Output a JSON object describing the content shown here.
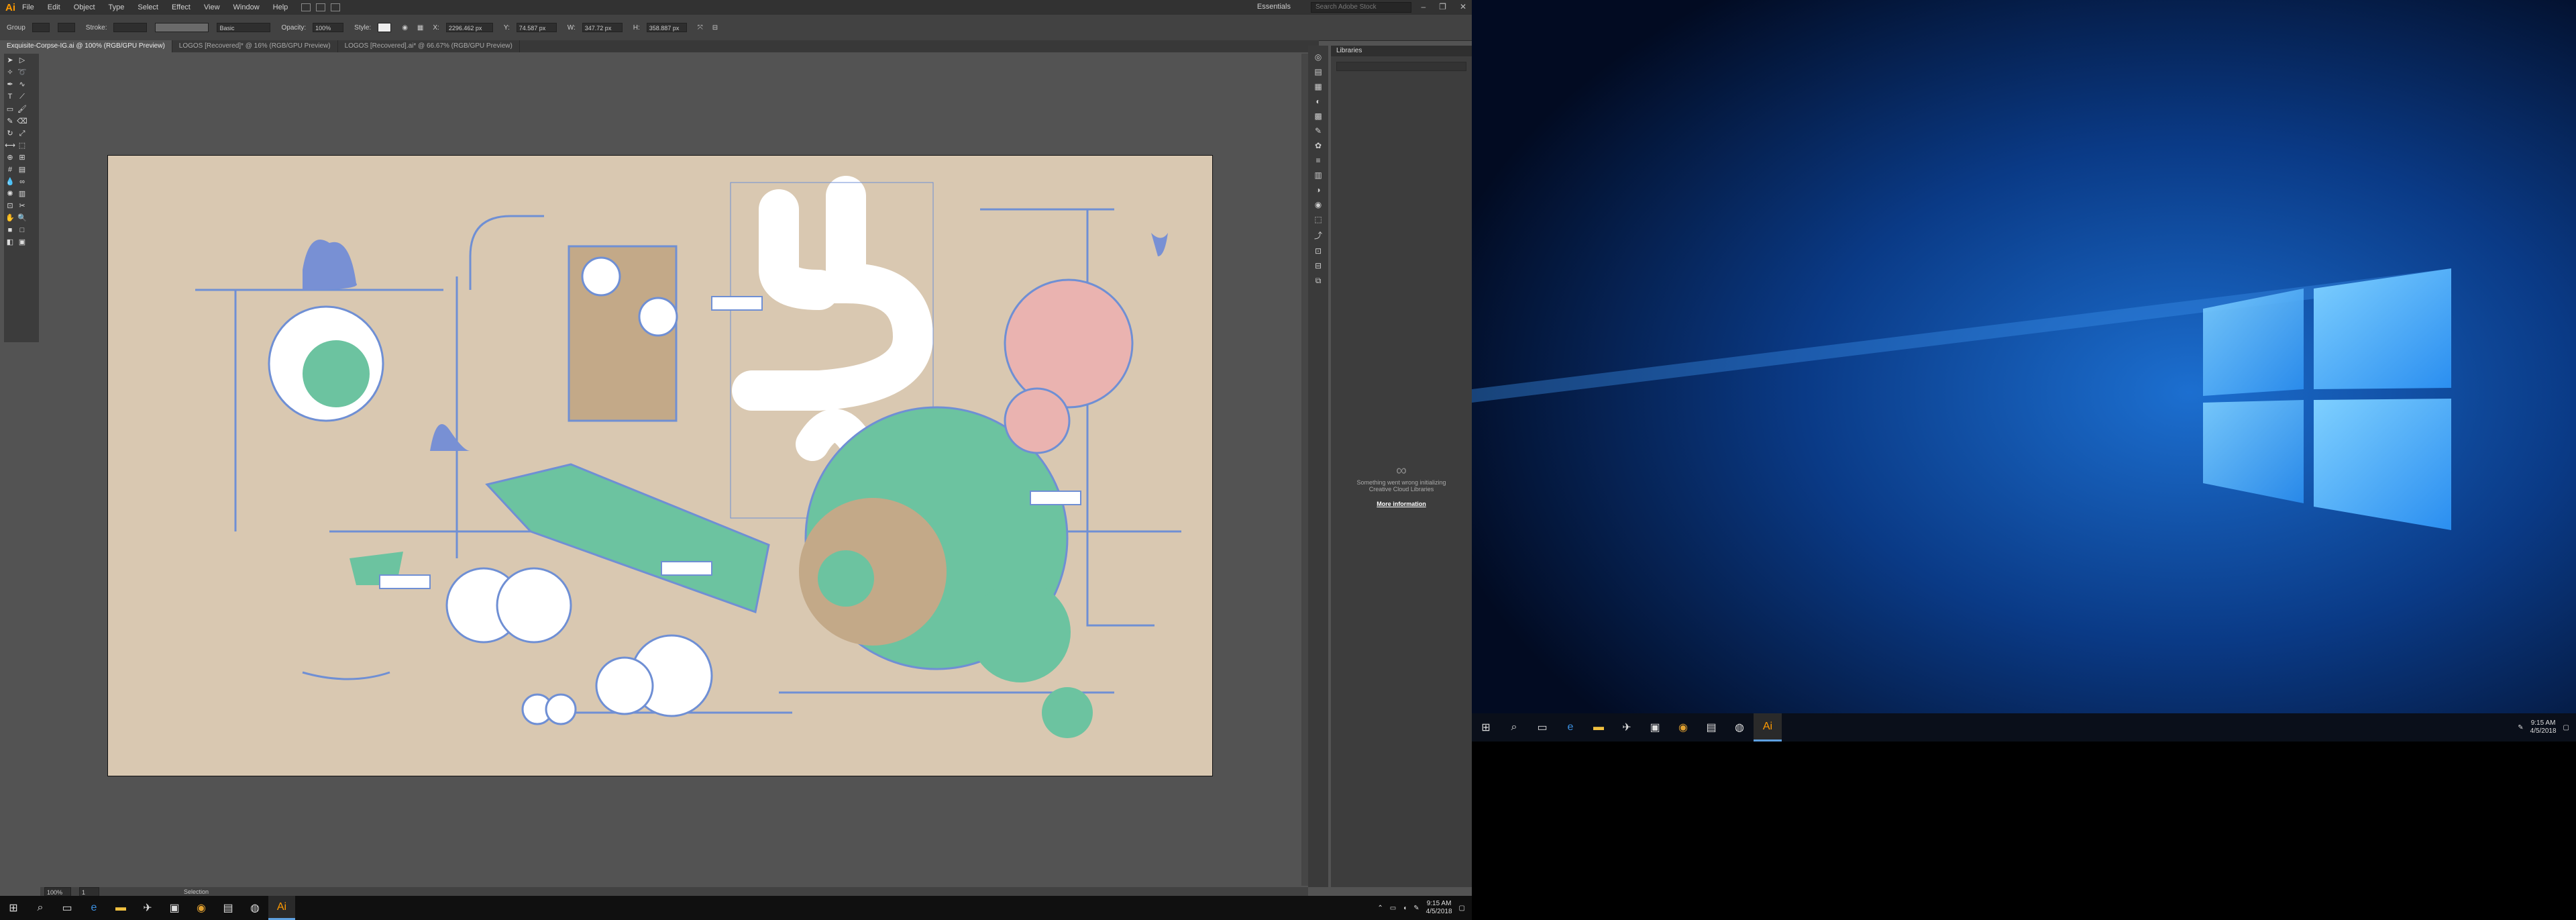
{
  "app": {
    "logo": "Ai",
    "menu": [
      "File",
      "Edit",
      "Object",
      "Type",
      "Select",
      "Effect",
      "View",
      "Window",
      "Help"
    ],
    "workspace": "Essentials",
    "search_placeholder": "Search Adobe Stock"
  },
  "control_bar": {
    "selection_label": "Group",
    "stroke_label": "Stroke:",
    "stroke_style": "Basic",
    "opacity_label": "Opacity:",
    "opacity_value": "100%",
    "style_label": "Style:",
    "x_value": "2296.462 px",
    "y_value": "74.587 px",
    "w_value": "347.72 px",
    "h_value": "358.887 px"
  },
  "tabs": [
    "Exquisite-Corpse-IG.ai @ 100% (RGB/GPU Preview)",
    "LOGOS [Recovered]* @ 16% (RGB/GPU Preview)",
    "LOGOS [Recovered].ai* @ 66.67% (RGB/GPU Preview)"
  ],
  "status": {
    "zoom": "100%",
    "page": "1",
    "mode": "Selection"
  },
  "libraries_panel": {
    "title": "Libraries",
    "error_line1": "Something went wrong initializing",
    "error_line2": "Creative Cloud Libraries",
    "more_info": "More information"
  },
  "taskbar": {
    "time": "9:15 AM",
    "date": "4/5/2018"
  },
  "desktop_taskbar": {
    "time": "9:15 AM",
    "date": "4/5/2018"
  },
  "colors": {
    "artboard": "#d9c8b1",
    "line_blue": "#6f8fd4",
    "green": "#6cc3a0",
    "pink": "#eab3b0",
    "tan": "#c3a988",
    "ai_orange": "#ff9a00"
  }
}
